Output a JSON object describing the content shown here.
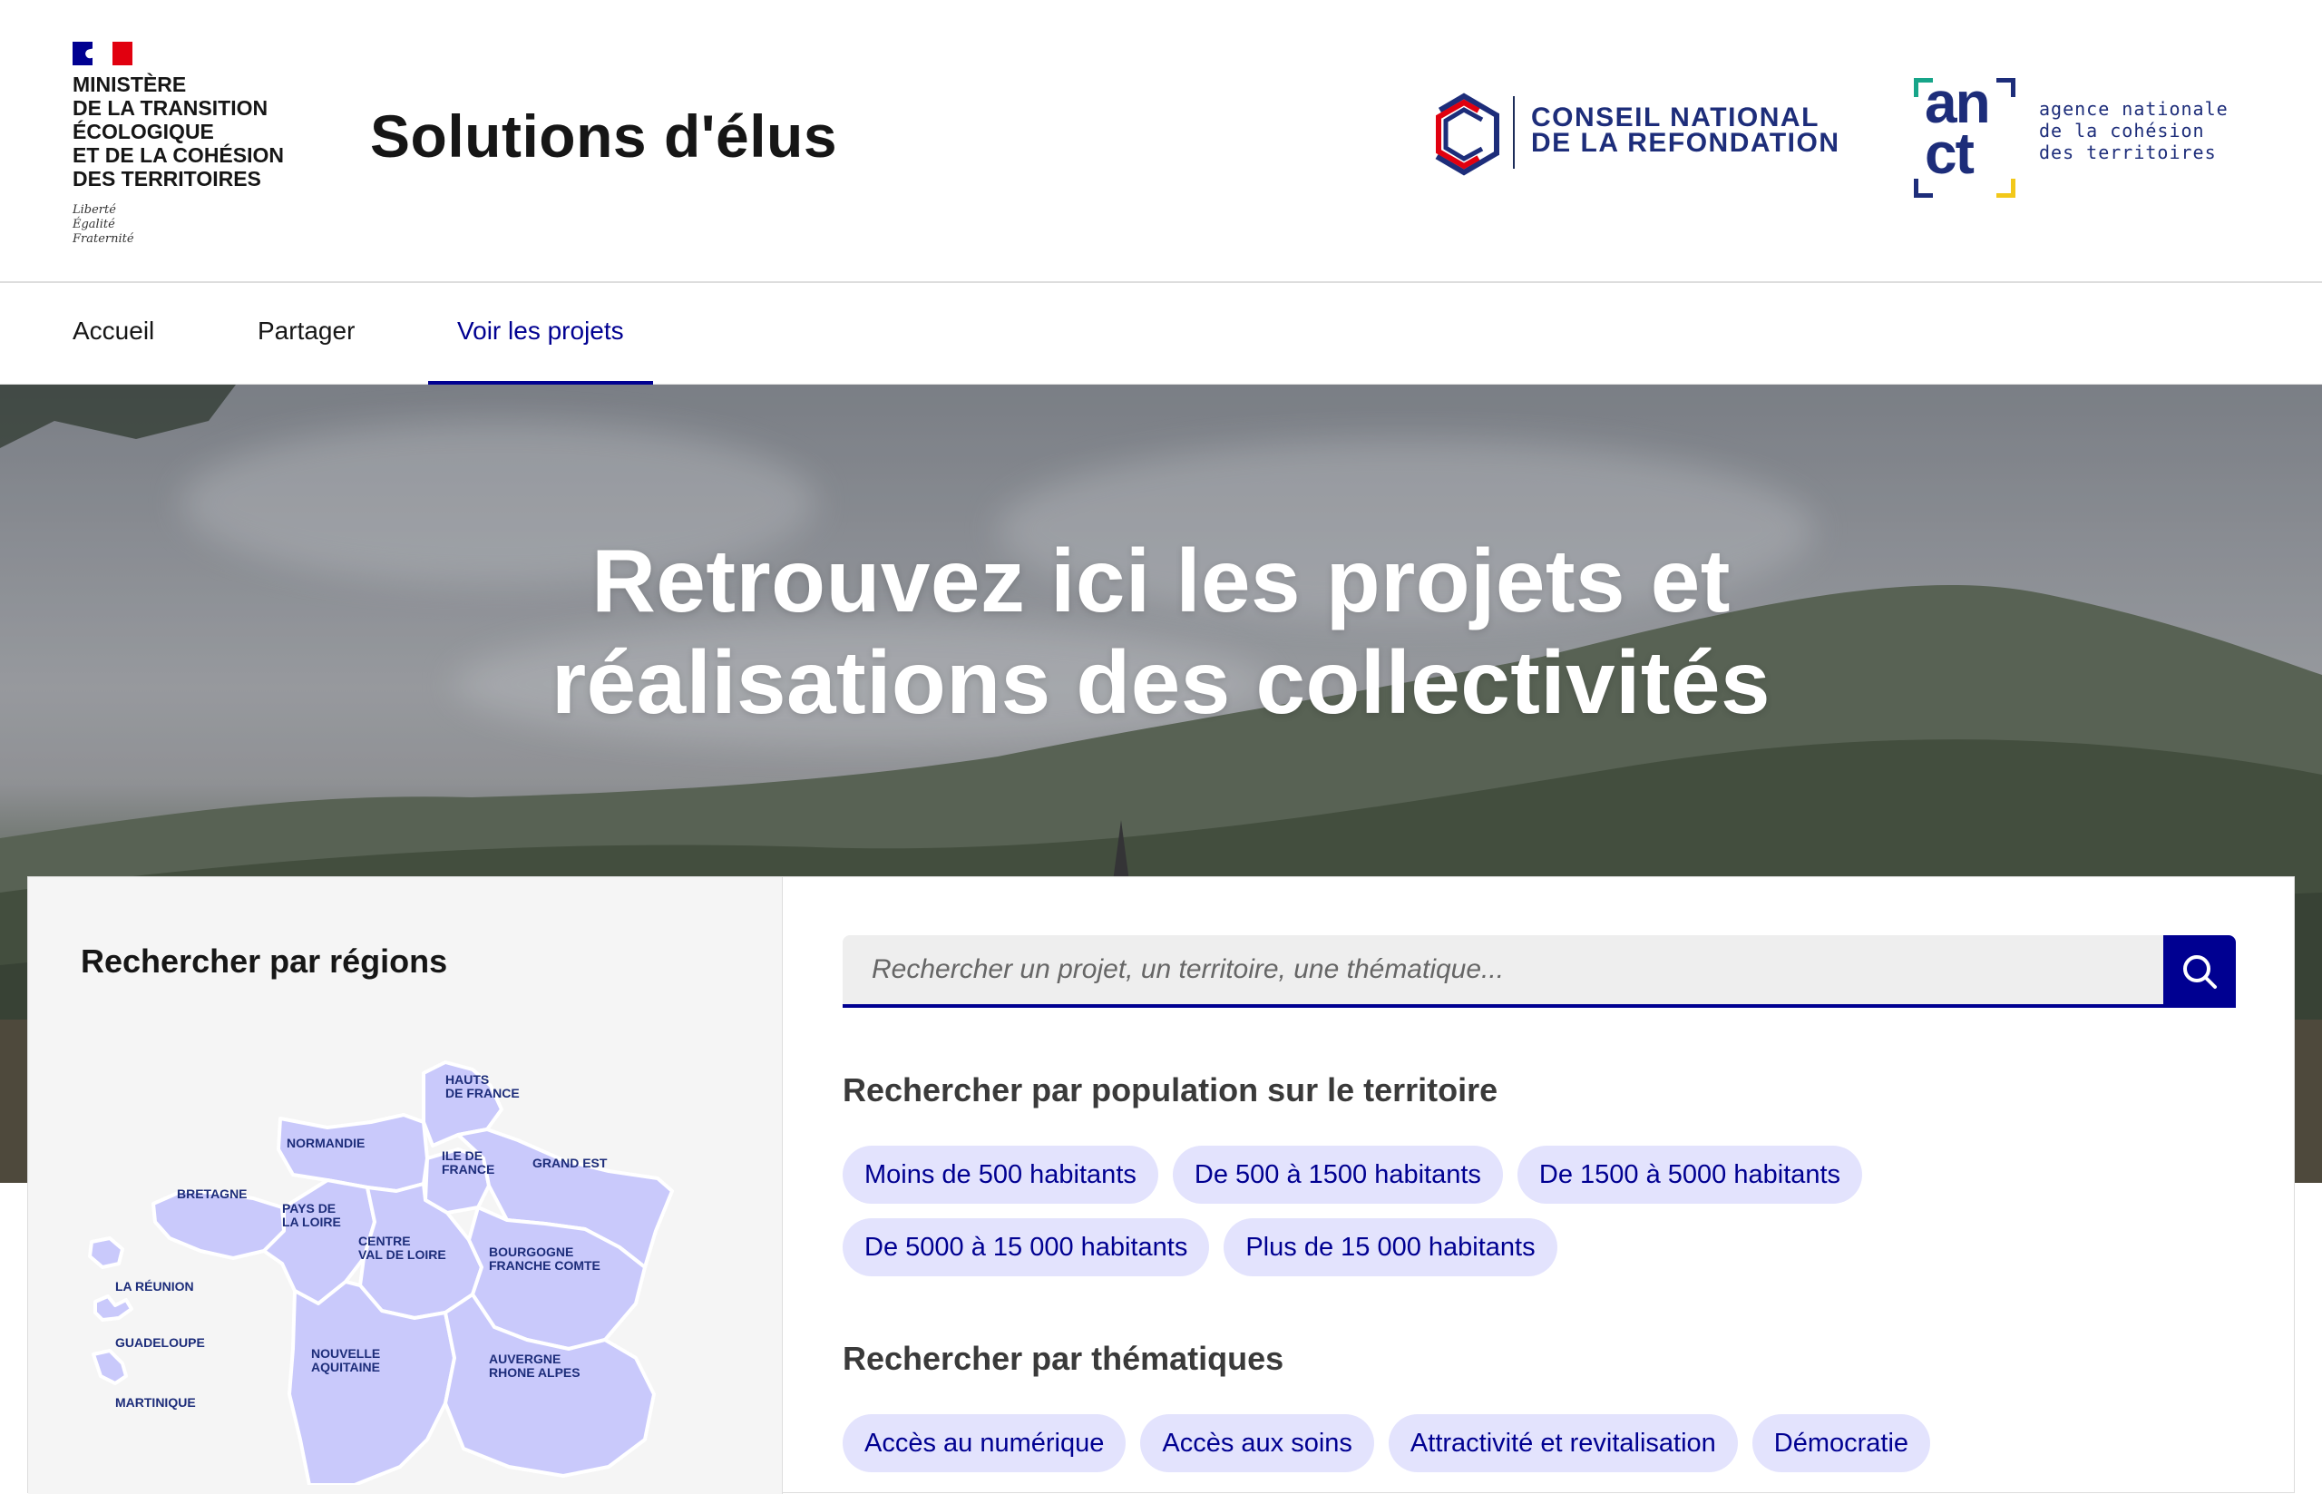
{
  "header": {
    "ministry_lines": [
      "Ministère",
      "de la transition",
      "écologique",
      "et de la cohésion",
      "des territoires"
    ],
    "devise": [
      "Liberté",
      "Égalité",
      "Fraternité"
    ],
    "site_title": "Solutions d'élus",
    "partner_cnr": [
      "CONSEIL NATIONAL",
      "DE LA REFONDATION"
    ],
    "partner_anct": {
      "mark_top": "an",
      "mark_bottom": "ct",
      "lines": [
        "agence nationale",
        "de la cohésion",
        "des territoires"
      ]
    }
  },
  "nav": {
    "items": [
      {
        "label": "Accueil",
        "active": false
      },
      {
        "label": "Partager",
        "active": false
      },
      {
        "label": "Voir les projets",
        "active": true
      }
    ]
  },
  "hero": {
    "title_line1": "Retrouvez ici les projets et",
    "title_line2": "réalisations des collectivités"
  },
  "regions_panel": {
    "title": "Rechercher par régions",
    "regions": {
      "hauts_de_france": [
        "HAUTS",
        "DE FRANCE"
      ],
      "normandie": [
        "NORMANDIE"
      ],
      "ile_de_france": [
        "ILE DE",
        "FRANCE"
      ],
      "grand_est": [
        "GRAND EST"
      ],
      "bretagne": [
        "BRETAGNE"
      ],
      "pays_de_la_loire": [
        "PAYS DE",
        "LA LOIRE"
      ],
      "centre": [
        "CENTRE",
        "VAL DE LOIRE"
      ],
      "bourgogne": [
        "BOURGOGNE",
        "FRANCHE COMTE"
      ],
      "la_reunion": [
        "LA RÉUNION"
      ],
      "guadeloupe": [
        "GUADELOUPE"
      ],
      "martinique": [
        "MARTINIQUE"
      ],
      "nouvelle_aquitaine": [
        "NOUVELLE",
        "AQUITAINE"
      ],
      "auvergne": [
        "AUVERGNE",
        "RHONE ALPES"
      ]
    }
  },
  "search": {
    "placeholder": "Rechercher un projet, un territoire, une thématique...",
    "button_icon": "search-icon"
  },
  "population": {
    "title": "Rechercher par population sur le territoire",
    "chips": [
      "Moins de 500 habitants",
      "De 500 à 1500 habitants",
      "De 1500 à 5000 habitants",
      "De 5000 à 15 000 habitants",
      "Plus de 15 000 habitants"
    ]
  },
  "thematiques": {
    "title": "Rechercher par thématiques",
    "chips": [
      "Accès au numérique",
      "Accès aux soins",
      "Attractivité et revitalisation",
      "Démocratie"
    ]
  },
  "colors": {
    "primary": "#000091",
    "chip_bg": "#e3e3fd",
    "map_fill": "#c9c9fb",
    "flag_red": "#e1000f"
  }
}
